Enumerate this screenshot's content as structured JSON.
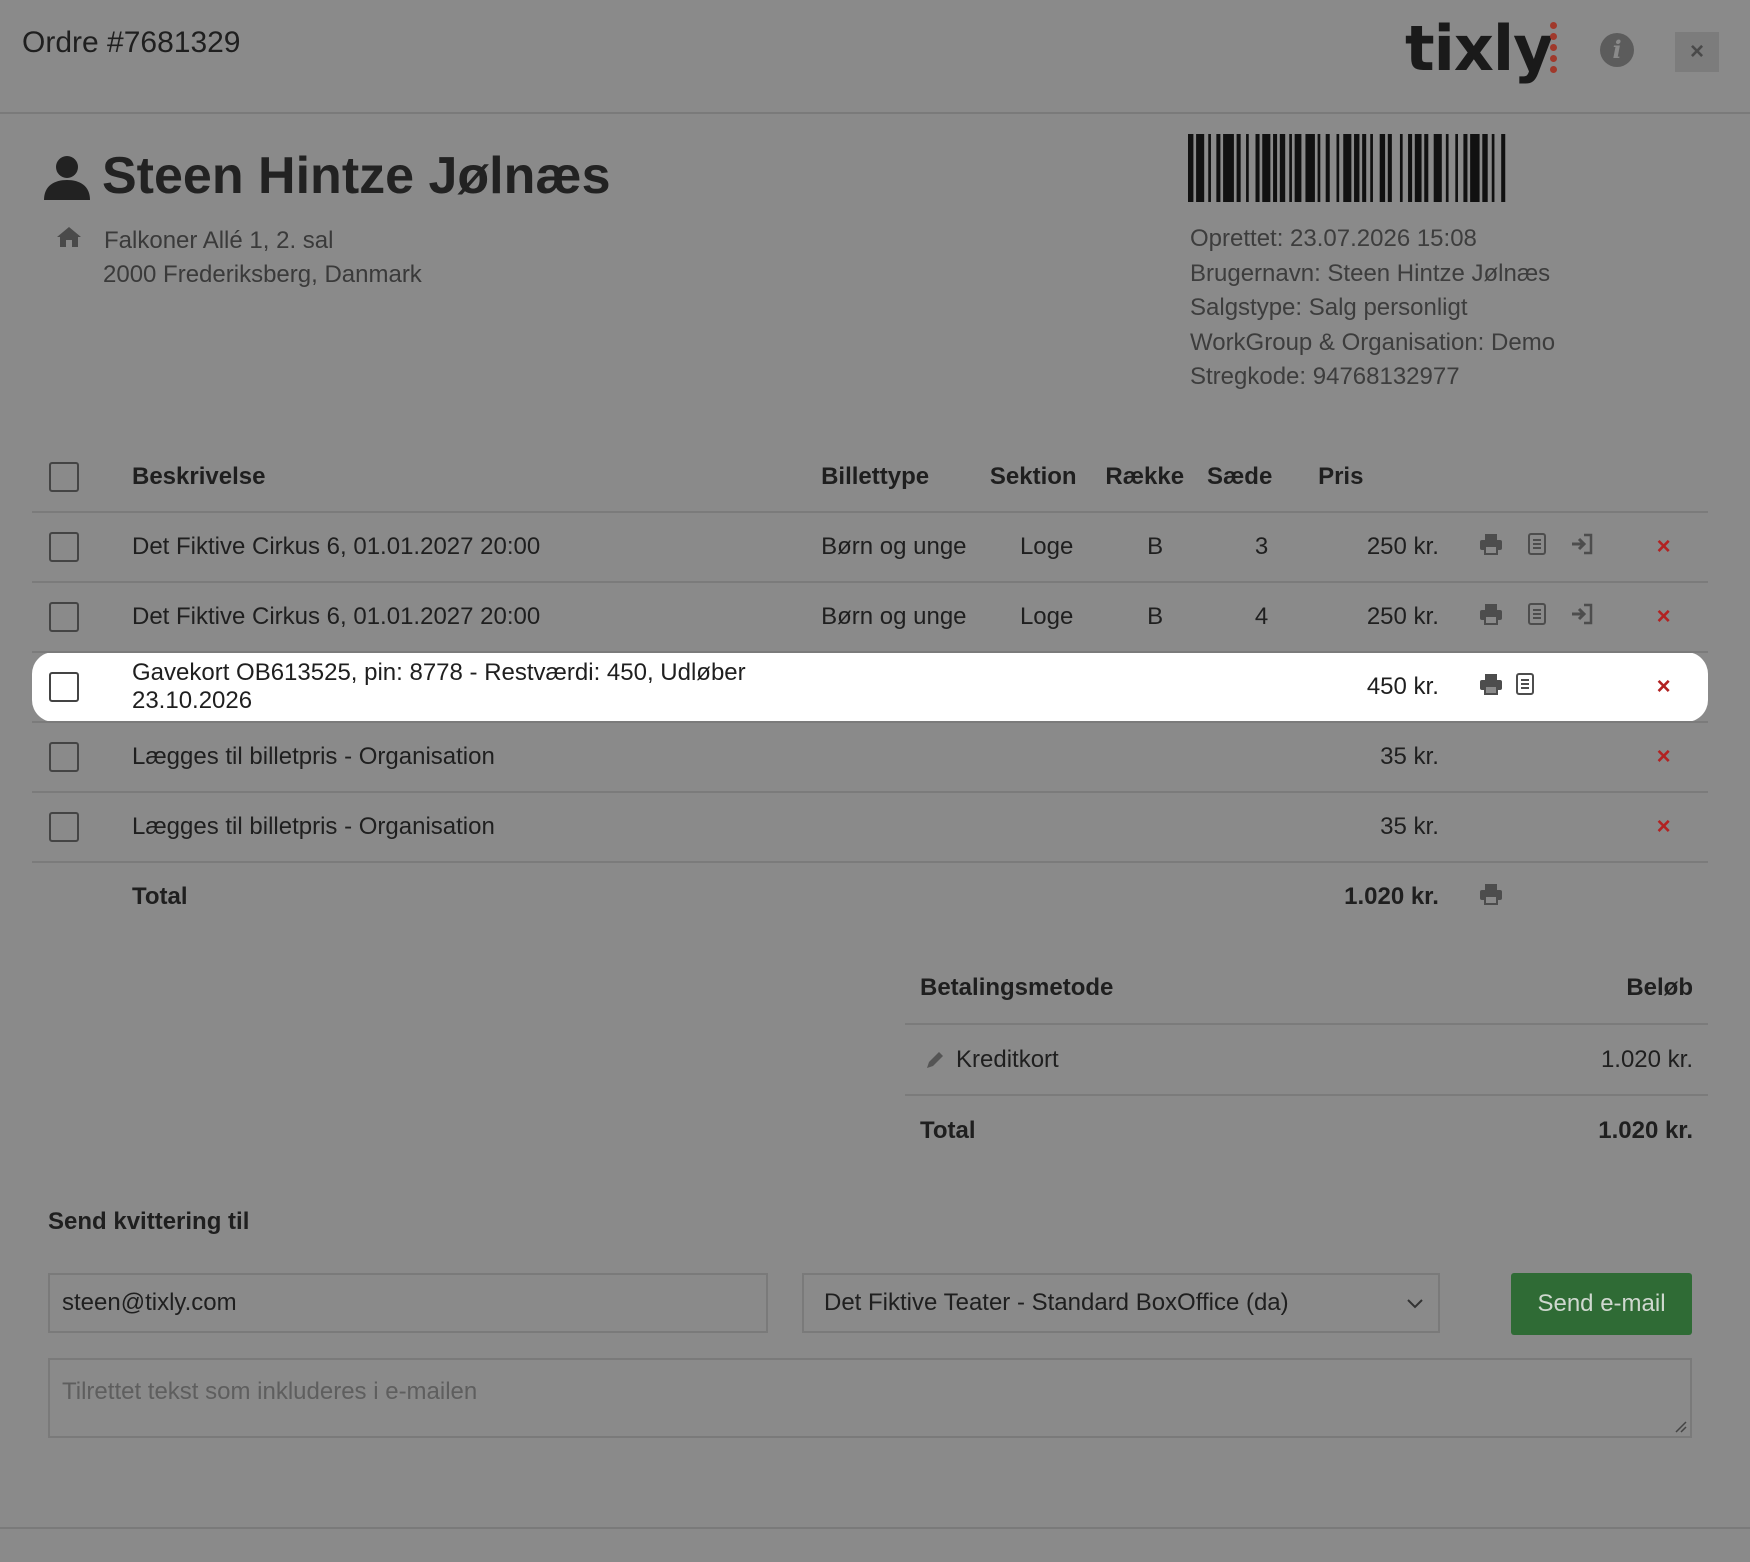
{
  "header": {
    "order_title": "Ordre #7681329",
    "logo_text": "tixly",
    "info_icon": "info-icon",
    "close_label": "×"
  },
  "customer": {
    "name": "Steen Hintze Jølnæs",
    "address_line1": "Falkoner Allé 1, 2. sal",
    "address_line2": "2000 Frederiksberg, Danmark"
  },
  "meta": {
    "created": "Oprettet: 23.07.2026 15:08",
    "username": "Brugernavn: Steen Hintze Jølnæs",
    "sale_type": "Salgstype: Salg personligt",
    "workgroup": "WorkGroup & Organisation: Demo",
    "barcode": "Stregkode: 94768132977"
  },
  "items_table": {
    "headers": {
      "description": "Beskrivelse",
      "ticket_type": "Billettype",
      "section": "Sektion",
      "row": "Række",
      "seat": "Sæde",
      "price": "Pris"
    },
    "rows": [
      {
        "description": "Det Fiktive Cirkus 6, 01.01.2027 20:00",
        "ticket_type": "Børn og unge",
        "section": "Loge",
        "row": "B",
        "seat": "3",
        "price": "250 kr."
      },
      {
        "description": "Det Fiktive Cirkus 6, 01.01.2027 20:00",
        "ticket_type": "Børn og unge",
        "section": "Loge",
        "row": "B",
        "seat": "4",
        "price": "250 kr."
      },
      {
        "description": "Gavekort OB613525, pin: 8778 - Restværdi: 450, Udløber 23.10.2026",
        "ticket_type": "",
        "section": "",
        "row": "",
        "seat": "",
        "price": "450 kr."
      },
      {
        "description": "Lægges til billetpris - Organisation",
        "ticket_type": "",
        "section": "",
        "row": "",
        "seat": "",
        "price": "35 kr."
      },
      {
        "description": "Lægges til billetpris - Organisation",
        "ticket_type": "",
        "section": "",
        "row": "",
        "seat": "",
        "price": "35 kr."
      }
    ],
    "total_label": "Total",
    "total_value": "1.020 kr.",
    "delete_glyph": "×"
  },
  "payment": {
    "method_header": "Betalingsmetode",
    "amount_header": "Beløb",
    "method": "Kreditkort",
    "amount": "1.020 kr.",
    "total_label": "Total",
    "total_value": "1.020 kr."
  },
  "receipt": {
    "label": "Send kvittering til",
    "email": "steen@tixly.com",
    "template": "Det Fiktive Teater - Standard BoxOffice (da)",
    "send_button": "Send e-mail",
    "message_placeholder": "Tilrettet tekst som inkluderes i e-mailen"
  },
  "colors": {
    "overlay": "#8a8a8a",
    "delete": "#b22222",
    "send_button": "#2f6b35",
    "logo_dots": "#a0392b"
  }
}
